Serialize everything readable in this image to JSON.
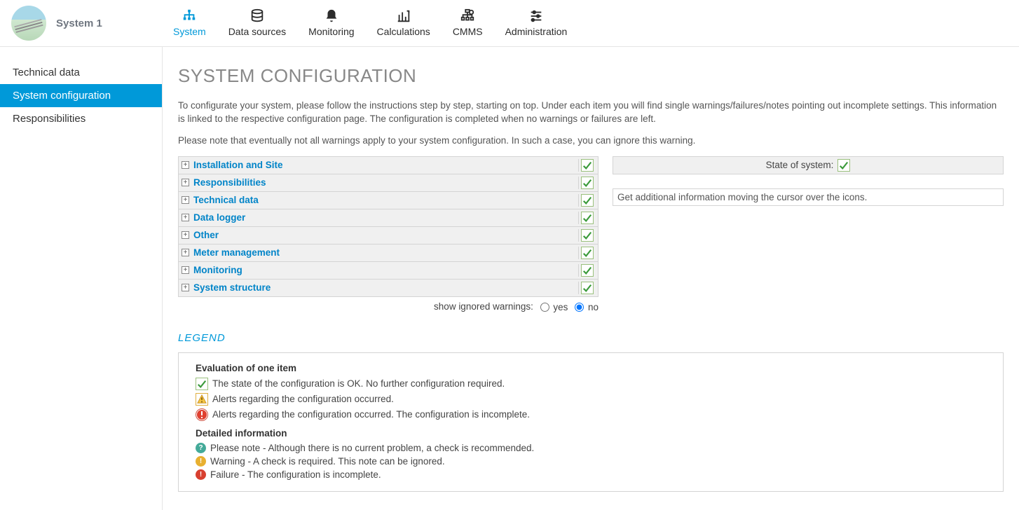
{
  "header": {
    "system_name": "System 1",
    "nav": [
      {
        "label": "System",
        "active": true
      },
      {
        "label": "Data sources",
        "active": false
      },
      {
        "label": "Monitoring",
        "active": false
      },
      {
        "label": "Calculations",
        "active": false
      },
      {
        "label": "CMMS",
        "active": false
      },
      {
        "label": "Administration",
        "active": false
      }
    ]
  },
  "sidebar": {
    "items": [
      {
        "label": "Technical data",
        "active": false
      },
      {
        "label": "System configuration",
        "active": true
      },
      {
        "label": "Responsibilities",
        "active": false
      }
    ]
  },
  "page": {
    "title": "SYSTEM CONFIGURATION",
    "intro1": "To configurate your system, please follow the instructions step by step, starting on top. Under each item you will find single warnings/failures/notes pointing out incomplete settings. This information is linked to the respective configuration page. The configuration is completed when no warnings or failures are left.",
    "intro2": "Please note that eventually not all warnings apply to your system configuration. In such a case, you can ignore this warning."
  },
  "config_items": [
    {
      "label": "Installation and Site",
      "status": "ok"
    },
    {
      "label": "Responsibilities",
      "status": "ok"
    },
    {
      "label": "Technical data",
      "status": "ok"
    },
    {
      "label": "Data logger",
      "status": "ok"
    },
    {
      "label": "Other",
      "status": "ok"
    },
    {
      "label": "Meter management",
      "status": "ok"
    },
    {
      "label": "Monitoring",
      "status": "ok"
    },
    {
      "label": "System structure",
      "status": "ok"
    }
  ],
  "ignored": {
    "label": "show ignored warnings:",
    "yes": "yes",
    "no": "no",
    "selected": "no"
  },
  "state": {
    "label": "State of system:",
    "info": "Get additional information moving the cursor over the icons."
  },
  "legend": {
    "title": "LEGEND",
    "eval_heading": "Evaluation of one item",
    "ok_text": "The state of the configuration is OK. No further configuration required.",
    "warn_text": "Alerts regarding the configuration occurred.",
    "fail_text": "Alerts regarding the configuration occurred. The configuration is incomplete.",
    "detail_heading": "Detailed information",
    "note_text": "Please note - Although there is no current problem, a check is recommended.",
    "warn2_text": "Warning - A check is required. This note can be ignored.",
    "fail2_text": "Failure - The configuration is incomplete."
  }
}
